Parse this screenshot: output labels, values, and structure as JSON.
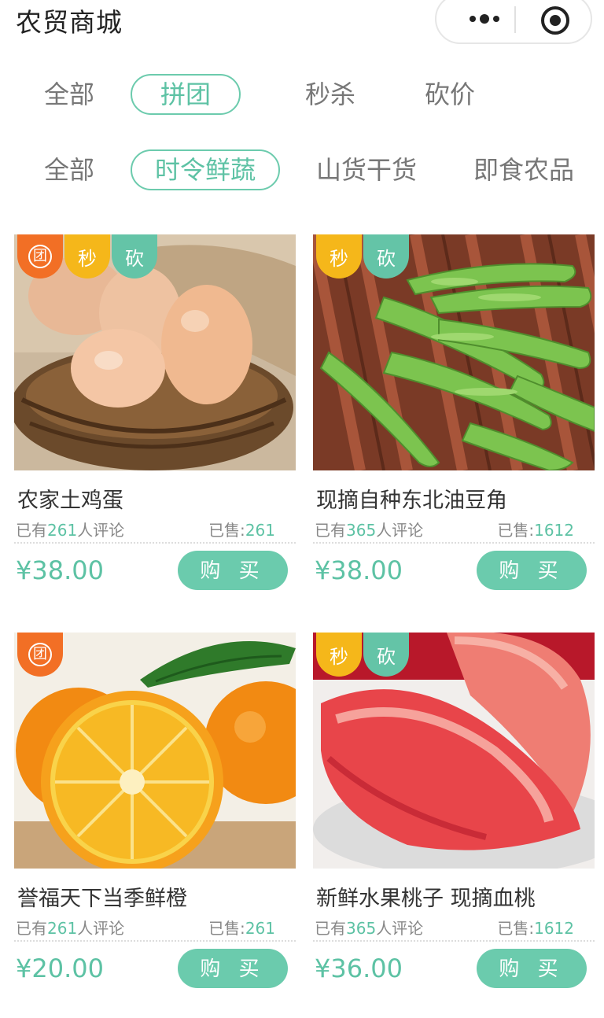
{
  "header": {
    "title": "农贸商城"
  },
  "tabs_row1": [
    "全部",
    "拼团",
    "秒杀",
    "砍价"
  ],
  "tabs_row2": [
    "全部",
    "时令鲜蔬",
    "山货干货",
    "即食农品"
  ],
  "badge_labels": {
    "tuan": "团",
    "miao": "秒",
    "kan": "砍"
  },
  "common": {
    "comments_prefix": "已有",
    "comments_suffix": "人评论",
    "sold_prefix": "已售:",
    "buy_label": "购 买"
  },
  "products": [
    {
      "name": "农家土鸡蛋",
      "comments": "261",
      "sold": "261",
      "price": "¥38.00"
    },
    {
      "name": "现摘自种东北油豆角",
      "comments": "365",
      "sold": "1612",
      "price": "¥38.00"
    },
    {
      "name": "誉福天下当季鲜橙",
      "comments": "261",
      "sold": "261",
      "price": "¥20.00"
    },
    {
      "name": "新鲜水果桃子 现摘血桃",
      "comments": "365",
      "sold": "1612",
      "price": "¥36.00"
    }
  ],
  "colors": {
    "accent": "#5dc2a4",
    "badge_tuan": "#f26f25",
    "badge_miao": "#f5b71a",
    "badge_kan": "#64c4a7"
  }
}
